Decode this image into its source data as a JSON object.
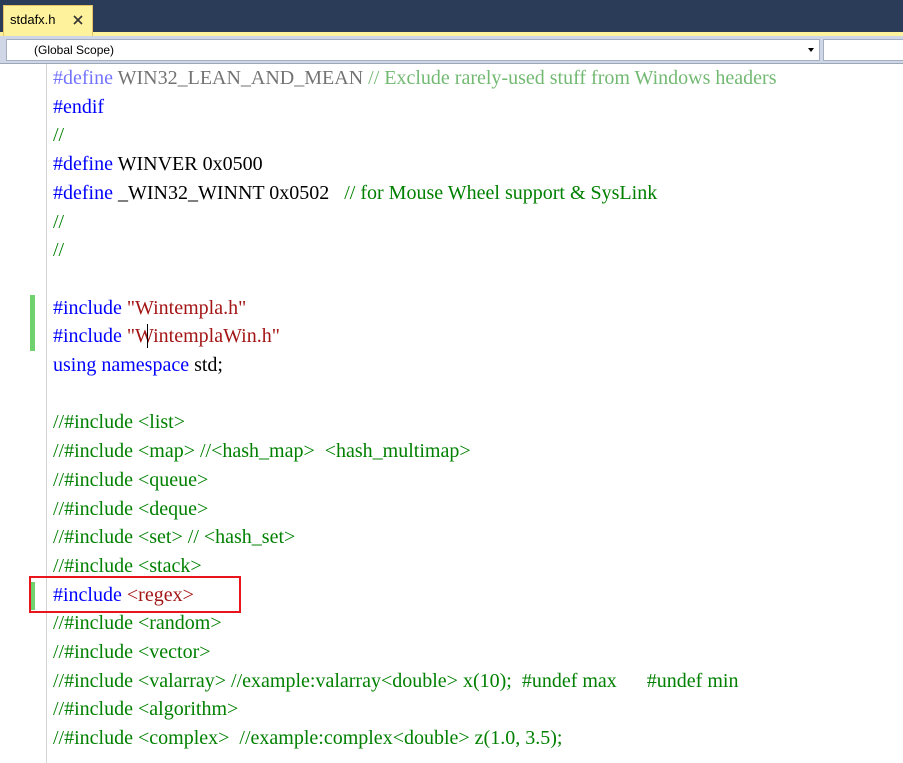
{
  "tab": {
    "label": "stdafx.h",
    "close_icon": "close-icon"
  },
  "navigation": {
    "scope": "(Global Scope)",
    "member": ""
  },
  "lines": [
    {
      "seg": [
        [
          "kw",
          "#define"
        ],
        [
          "plain",
          " WIN32_LEAN_AND_MEAN "
        ],
        [
          "cmt",
          "// Exclude rarely-used stuff from Windows headers"
        ]
      ],
      "dim": true
    },
    {
      "seg": [
        [
          "kw",
          "#endif"
        ]
      ]
    },
    {
      "seg": [
        [
          "cmt",
          "//"
        ]
      ]
    },
    {
      "seg": [
        [
          "kw",
          "#define"
        ],
        [
          "plain",
          " WINVER 0x0500"
        ]
      ]
    },
    {
      "seg": [
        [
          "kw",
          "#define"
        ],
        [
          "plain",
          " _WIN32_WINNT 0x0502   "
        ],
        [
          "cmt",
          "// for Mouse Wheel support & SysLink"
        ]
      ]
    },
    {
      "seg": [
        [
          "cmt",
          "//"
        ]
      ]
    },
    {
      "seg": [
        [
          "cmt",
          "//"
        ]
      ]
    },
    {
      "seg": []
    },
    {
      "seg": [
        [
          "kw",
          "#include"
        ],
        [
          "plain",
          " "
        ],
        [
          "str",
          "\"Wintempla.h\""
        ]
      ]
    },
    {
      "seg": [
        [
          "kw",
          "#include"
        ],
        [
          "plain",
          " "
        ],
        [
          "str",
          "\"WintemplaWin.h\""
        ]
      ]
    },
    {
      "seg": [
        [
          "kw",
          "using"
        ],
        [
          "plain",
          " "
        ],
        [
          "kw",
          "namespace"
        ],
        [
          "plain",
          " std;"
        ]
      ]
    },
    {
      "seg": []
    },
    {
      "seg": [
        [
          "cmt",
          "//#include <list>"
        ]
      ]
    },
    {
      "seg": [
        [
          "cmt",
          "//#include <map> //<hash_map>  <hash_multimap>"
        ]
      ]
    },
    {
      "seg": [
        [
          "cmt",
          "//#include <queue>"
        ]
      ]
    },
    {
      "seg": [
        [
          "cmt",
          "//#include <deque>"
        ]
      ]
    },
    {
      "seg": [
        [
          "cmt",
          "//#include <set> // <hash_set>"
        ]
      ]
    },
    {
      "seg": [
        [
          "cmt",
          "//#include <stack>"
        ]
      ]
    },
    {
      "seg": [
        [
          "kw",
          "#include"
        ],
        [
          "plain",
          " "
        ],
        [
          "str",
          "<regex>"
        ]
      ]
    },
    {
      "seg": [
        [
          "cmt",
          "//#include <random>"
        ]
      ]
    },
    {
      "seg": [
        [
          "cmt",
          "//#include <vector>"
        ]
      ]
    },
    {
      "seg": [
        [
          "cmt",
          "//#include <valarray> //example:valarray<double> x(10);  #undef max      #undef min"
        ]
      ]
    },
    {
      "seg": [
        [
          "cmt",
          "//#include <algorithm>"
        ]
      ]
    },
    {
      "seg": [
        [
          "cmt",
          "//#include <complex>  //example:complex<double> z(1.0, 3.5);"
        ]
      ]
    }
  ],
  "colors": {
    "keyword": "#0000ff",
    "string": "#a31515",
    "comment": "#008000",
    "tab_bg": "#fff29d",
    "highlight": "#e8161c",
    "change_bar": "#6fd26f"
  }
}
